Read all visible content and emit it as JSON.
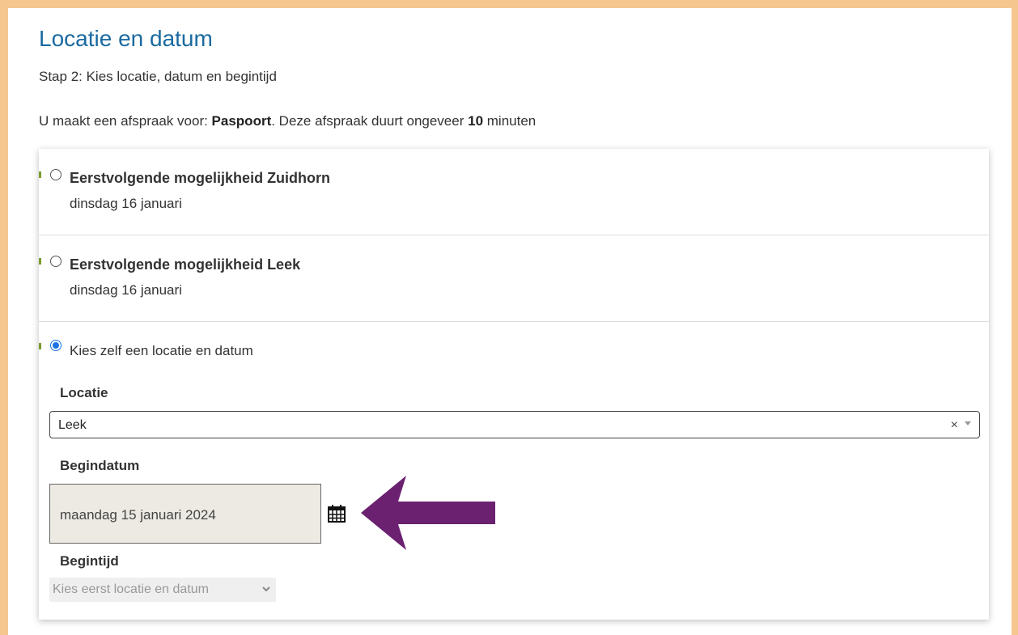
{
  "page": {
    "title": "Locatie en datum",
    "subtitle": "Stap 2: Kies locatie, datum en begintijd",
    "intro_prefix": "U maakt een afspraak voor: ",
    "intro_product": "Paspoort",
    "intro_middle": ". Deze afspraak duurt ongeveer ",
    "intro_duration": "10",
    "intro_suffix": " minuten"
  },
  "options": [
    {
      "title": "Eerstvolgende mogelijkheid Zuidhorn",
      "date": "dinsdag 16 januari",
      "selected": false
    },
    {
      "title": "Eerstvolgende mogelijkheid Leek",
      "date": "dinsdag 16 januari",
      "selected": false
    },
    {
      "title": "Kies zelf een locatie en datum",
      "selected": true
    }
  ],
  "form": {
    "location_label": "Locatie",
    "location_value": "Leek",
    "location_clear": "×",
    "startdate_label": "Begindatum",
    "startdate_value": "maandag 15 januari 2024",
    "starttime_label": "Begintijd",
    "starttime_value": "Kies eerst locatie en datum"
  },
  "icons": {
    "calendar": "calendar-icon",
    "arrow": "arrow-left-icon",
    "chevron": "chevron-down-icon"
  },
  "colors": {
    "frame": "#f5c78f",
    "title": "#1a6aa0",
    "arrow": "#6b2170",
    "radio_selected": "#1a73e8",
    "marker": "#7a9b2c"
  }
}
